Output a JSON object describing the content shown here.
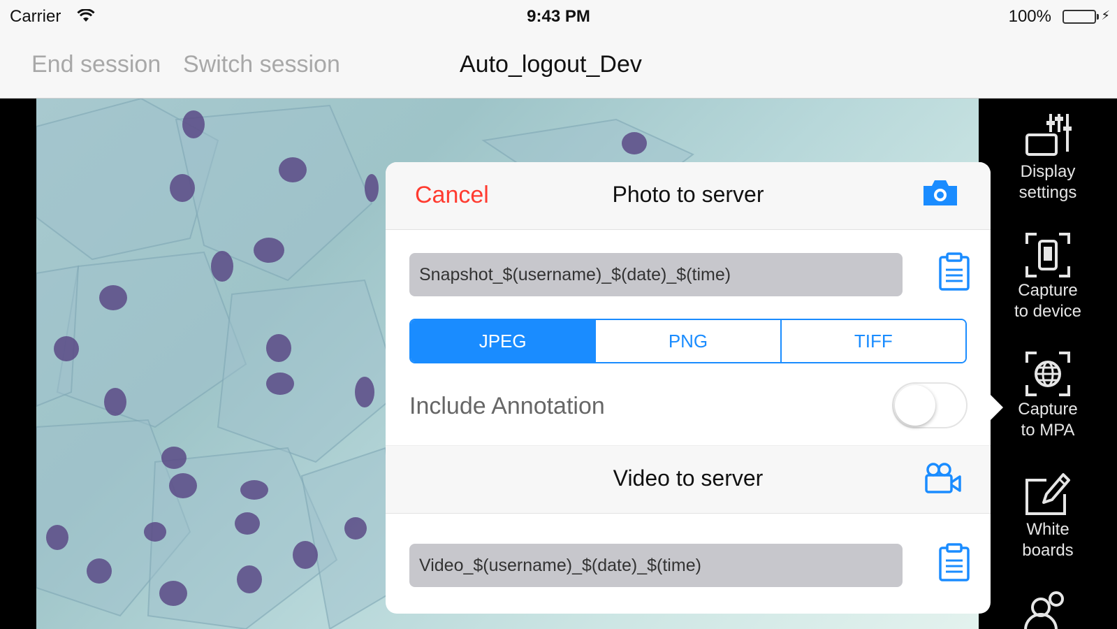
{
  "status_bar": {
    "carrier": "Carrier",
    "time": "9:43 PM",
    "battery": "100%",
    "battery_level": 1.0
  },
  "nav": {
    "end_session": "End session",
    "switch_session": "Switch session",
    "title": "Auto_logout_Dev"
  },
  "colors": {
    "accent": "#1a8cff",
    "cancel": "#ff3b30",
    "field_bg": "#c7c7cc"
  },
  "photo": {
    "cancel_label": "Cancel",
    "title": "Photo to server",
    "camera_icon": "camera-icon",
    "filename": "Snapshot_$(username)_$(date)_$(time)",
    "clipboard_icon": "clipboard-icon",
    "formats": [
      "JPEG",
      "PNG",
      "TIFF"
    ],
    "selected_format": "JPEG",
    "include_annotation_label": "Include Annotation",
    "include_annotation": false
  },
  "video": {
    "title": "Video to server",
    "video_camera_icon": "video-camera-icon",
    "filename": "Video_$(username)_$(date)_$(time)",
    "clipboard_icon": "clipboard-icon"
  },
  "sidebar": {
    "items": [
      {
        "label": "Display\nsettings",
        "icon": "sliders-icon"
      },
      {
        "label": "Capture\nto device",
        "icon": "capture-device-icon"
      },
      {
        "label": "Capture\nto MPA",
        "icon": "capture-globe-icon"
      },
      {
        "label": "White\nboards",
        "icon": "whiteboard-pencil-icon"
      },
      {
        "label": "",
        "icon": "users-icon"
      }
    ]
  }
}
